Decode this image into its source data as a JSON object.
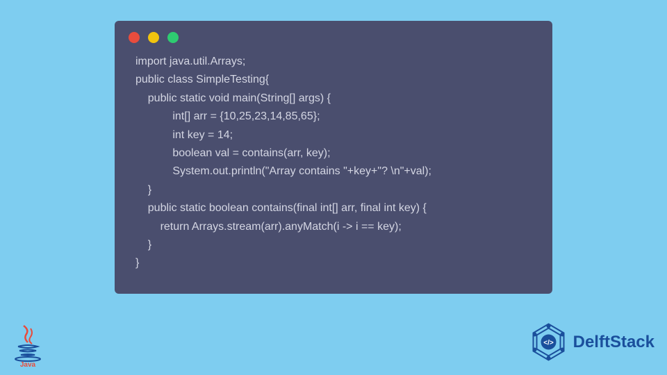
{
  "code": {
    "lines": [
      "import java.util.Arrays;",
      "public class SimpleTesting{",
      "    public static void main(String[] args) {",
      "            int[] arr = {10,25,23,14,85,65};",
      "            int key = 14;",
      "            boolean val = contains(arr, key);",
      "            System.out.println(\"Array contains \"+key+\"? \\n\"+val);",
      "    }",
      "    public static boolean contains(final int[] arr, final int key) {",
      "        return Arrays.stream(arr).anyMatch(i -> i == key);",
      "    }",
      "}"
    ]
  },
  "logos": {
    "java_label": "Java",
    "delftstack_label": "DelftStack"
  },
  "window": {
    "dot_red": "#e84c3d",
    "dot_yellow": "#f1c40f",
    "dot_green": "#2ecc71"
  }
}
